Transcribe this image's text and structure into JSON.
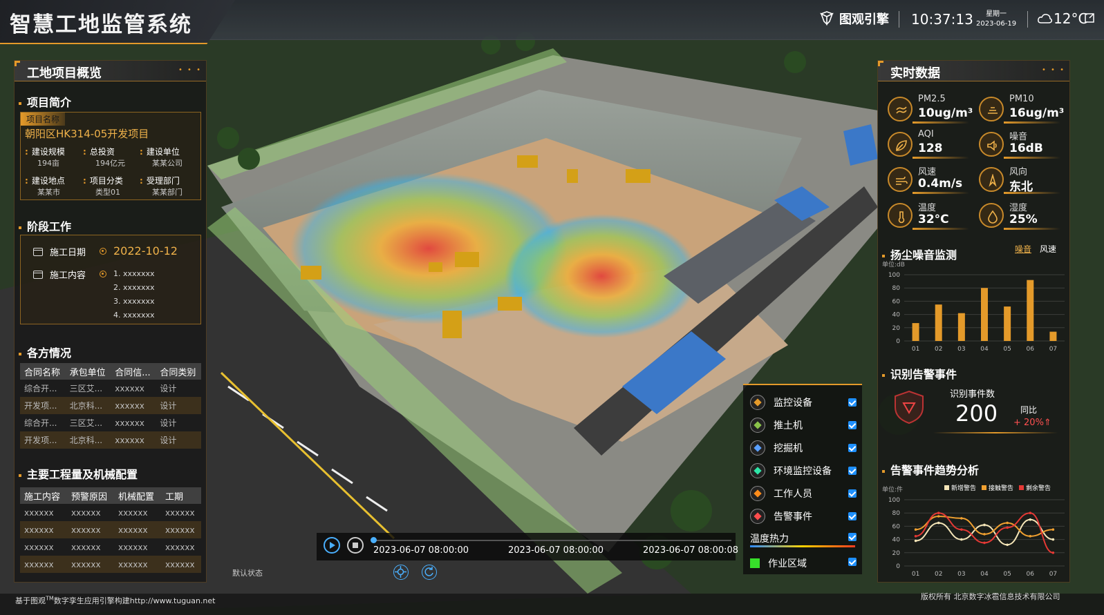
{
  "header": {
    "title": "智慧工地监管系统",
    "brand": "图观引擎",
    "time": "10:37:13",
    "weekday": "星期一",
    "date": "2023-06-19",
    "temperature": "12°C"
  },
  "left": {
    "panel_title": "工地项目概览",
    "intro": {
      "title": "项目简介",
      "tag": "项目名称",
      "project_name": "朝阳区HK314-05开发项目",
      "fields": [
        {
          "k": "建设规模",
          "v": "194亩"
        },
        {
          "k": "总投资",
          "v": "194亿元"
        },
        {
          "k": "建设单位",
          "v": "某某公司"
        },
        {
          "k": "建设地点",
          "v": "某某市"
        },
        {
          "k": "项目分类",
          "v": "类型01"
        },
        {
          "k": "受理部门",
          "v": "某某部门"
        }
      ]
    },
    "stage": {
      "title": "阶段工作",
      "date_label": "施工日期",
      "date_value": "2022-10-12",
      "content_label": "施工内容",
      "items": [
        "1.  xxxxxxx",
        "2.  xxxxxxx",
        "3.  xxxxxxx",
        "4.  xxxxxxx"
      ]
    },
    "parties": {
      "title": "各方情况",
      "headers": [
        "合同名称",
        "承包单位",
        "合同信...",
        "合同类别"
      ],
      "rows": [
        [
          "综合开...",
          "三区艾...",
          "xxxxxx",
          "设计"
        ],
        [
          "开发项...",
          "北京科...",
          "xxxxxx",
          "设计"
        ],
        [
          "综合开...",
          "三区艾...",
          "xxxxxx",
          "设计"
        ],
        [
          "开发项...",
          "北京科...",
          "xxxxxx",
          "设计"
        ]
      ]
    },
    "works": {
      "title": "主要工程量及机械配置",
      "headers": [
        "施工内容",
        "预警原因",
        "机械配置",
        "工期"
      ],
      "rows": [
        [
          "xxxxxx",
          "xxxxxx",
          "xxxxxx",
          "xxxxxx"
        ],
        [
          "xxxxxx",
          "xxxxxx",
          "xxxxxx",
          "xxxxxx"
        ],
        [
          "xxxxxx",
          "xxxxxx",
          "xxxxxx",
          "xxxxxx"
        ],
        [
          "xxxxxx",
          "xxxxxx",
          "xxxxxx",
          "xxxxxx"
        ]
      ]
    }
  },
  "right": {
    "panel_title": "实时数据",
    "metrics": [
      {
        "label": "PM2.5",
        "value": "10ug/m³",
        "icon": "pm25-icon"
      },
      {
        "label": "PM10",
        "value": "16ug/m³",
        "icon": "pm10-icon"
      },
      {
        "label": "AQI",
        "value": "128",
        "icon": "leaf-icon"
      },
      {
        "label": "噪音",
        "value": "16dB",
        "icon": "speaker-icon"
      },
      {
        "label": "风速",
        "value": "0.4m/s",
        "icon": "wind-speed-icon"
      },
      {
        "label": "风向",
        "value": "东北",
        "icon": "wind-direction-icon"
      },
      {
        "label": "温度",
        "value": "32°C",
        "icon": "thermometer-icon"
      },
      {
        "label": "湿度",
        "value": "25%",
        "icon": "droplet-icon"
      }
    ],
    "dust": {
      "title": "扬尘噪音监测",
      "tab_noise": "噪音",
      "tab_wind": "风速",
      "unit": "单位:dB"
    },
    "alarm": {
      "title": "识别告警事件",
      "count_label": "识别事件数",
      "count": "200",
      "yoy_label": "同比",
      "yoy": "+ 20%"
    },
    "trend": {
      "title": "告警事件趋势分析",
      "unit": "单位:件",
      "legend": [
        "新增警告",
        "接触警告",
        "剩余警告"
      ]
    }
  },
  "legend_panel": {
    "items": [
      {
        "label": "监控设备",
        "color": "#e49a2a"
      },
      {
        "label": "推土机",
        "color": "#8bc34a"
      },
      {
        "label": "挖掘机",
        "color": "#5aa0ff"
      },
      {
        "label": "环境监控设备",
        "color": "#2ee6a8"
      },
      {
        "label": "工作人员",
        "color": "#ff8c1a"
      },
      {
        "label": "告警事件",
        "color": "#ff4d4d"
      }
    ],
    "heat": "温度热力",
    "area": "作业区域"
  },
  "timeline": {
    "t1": "2023-06-07 08:00:00",
    "t2": "2023-06-07 08:00:00",
    "t3": "2023-06-07 08:00:08",
    "state": "默认状态"
  },
  "footer": {
    "left_a": "基于图观",
    "left_tm": "TM",
    "left_b": "数字孪生应用引擎构建http://www.tuguan.net",
    "right": "版权所有  北京数字冰雹信息技术有限公司"
  },
  "colors": {
    "accent": "#e49a2a",
    "blue": "#4ab0ff"
  },
  "chart_data": [
    {
      "type": "bar",
      "title": "扬尘噪音监测",
      "categories": [
        "01",
        "02",
        "03",
        "04",
        "05",
        "06",
        "07"
      ],
      "series": [
        {
          "name": "噪音",
          "values": [
            27,
            55,
            42,
            80,
            52,
            92,
            14
          ]
        }
      ],
      "ylabel": "单位:dB",
      "ylim": [
        0,
        100
      ],
      "yticks": [
        0,
        20,
        40,
        60,
        80,
        100
      ],
      "grid": true
    },
    {
      "type": "line",
      "title": "告警事件趋势分析",
      "categories": [
        "01",
        "02",
        "03",
        "04",
        "05",
        "06",
        "07"
      ],
      "ylabel": "单位:件",
      "ylim": [
        0,
        100
      ],
      "yticks": [
        0,
        20,
        40,
        60,
        80,
        100
      ],
      "series": [
        {
          "name": "新增警告",
          "color": "#f5e6b8",
          "values": [
            38,
            65,
            40,
            62,
            32,
            70,
            40
          ]
        },
        {
          "name": "接触警告",
          "color": "#f0a030",
          "values": [
            55,
            75,
            72,
            48,
            65,
            45,
            55
          ]
        },
        {
          "name": "剩余警告",
          "color": "#e53935",
          "values": [
            45,
            80,
            55,
            35,
            58,
            80,
            20
          ]
        }
      ],
      "legend": "top-right",
      "grid": true
    }
  ]
}
